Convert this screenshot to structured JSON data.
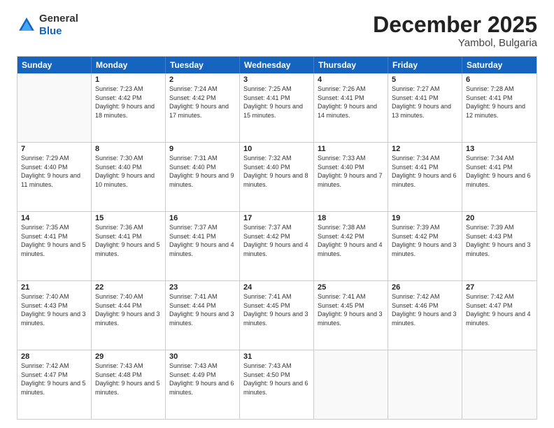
{
  "header": {
    "logo_general": "General",
    "logo_blue": "Blue",
    "title": "December 2025",
    "location": "Yambol, Bulgaria"
  },
  "days_of_week": [
    "Sunday",
    "Monday",
    "Tuesday",
    "Wednesday",
    "Thursday",
    "Friday",
    "Saturday"
  ],
  "weeks": [
    [
      {
        "day": "",
        "empty": true
      },
      {
        "day": "1",
        "sunrise": "Sunrise: 7:23 AM",
        "sunset": "Sunset: 4:42 PM",
        "daylight": "Daylight: 9 hours and 18 minutes."
      },
      {
        "day": "2",
        "sunrise": "Sunrise: 7:24 AM",
        "sunset": "Sunset: 4:42 PM",
        "daylight": "Daylight: 9 hours and 17 minutes."
      },
      {
        "day": "3",
        "sunrise": "Sunrise: 7:25 AM",
        "sunset": "Sunset: 4:41 PM",
        "daylight": "Daylight: 9 hours and 15 minutes."
      },
      {
        "day": "4",
        "sunrise": "Sunrise: 7:26 AM",
        "sunset": "Sunset: 4:41 PM",
        "daylight": "Daylight: 9 hours and 14 minutes."
      },
      {
        "day": "5",
        "sunrise": "Sunrise: 7:27 AM",
        "sunset": "Sunset: 4:41 PM",
        "daylight": "Daylight: 9 hours and 13 minutes."
      },
      {
        "day": "6",
        "sunrise": "Sunrise: 7:28 AM",
        "sunset": "Sunset: 4:41 PM",
        "daylight": "Daylight: 9 hours and 12 minutes."
      }
    ],
    [
      {
        "day": "7",
        "sunrise": "Sunrise: 7:29 AM",
        "sunset": "Sunset: 4:40 PM",
        "daylight": "Daylight: 9 hours and 11 minutes."
      },
      {
        "day": "8",
        "sunrise": "Sunrise: 7:30 AM",
        "sunset": "Sunset: 4:40 PM",
        "daylight": "Daylight: 9 hours and 10 minutes."
      },
      {
        "day": "9",
        "sunrise": "Sunrise: 7:31 AM",
        "sunset": "Sunset: 4:40 PM",
        "daylight": "Daylight: 9 hours and 9 minutes."
      },
      {
        "day": "10",
        "sunrise": "Sunrise: 7:32 AM",
        "sunset": "Sunset: 4:40 PM",
        "daylight": "Daylight: 9 hours and 8 minutes."
      },
      {
        "day": "11",
        "sunrise": "Sunrise: 7:33 AM",
        "sunset": "Sunset: 4:40 PM",
        "daylight": "Daylight: 9 hours and 7 minutes."
      },
      {
        "day": "12",
        "sunrise": "Sunrise: 7:34 AM",
        "sunset": "Sunset: 4:41 PM",
        "daylight": "Daylight: 9 hours and 6 minutes."
      },
      {
        "day": "13",
        "sunrise": "Sunrise: 7:34 AM",
        "sunset": "Sunset: 4:41 PM",
        "daylight": "Daylight: 9 hours and 6 minutes."
      }
    ],
    [
      {
        "day": "14",
        "sunrise": "Sunrise: 7:35 AM",
        "sunset": "Sunset: 4:41 PM",
        "daylight": "Daylight: 9 hours and 5 minutes."
      },
      {
        "day": "15",
        "sunrise": "Sunrise: 7:36 AM",
        "sunset": "Sunset: 4:41 PM",
        "daylight": "Daylight: 9 hours and 5 minutes."
      },
      {
        "day": "16",
        "sunrise": "Sunrise: 7:37 AM",
        "sunset": "Sunset: 4:41 PM",
        "daylight": "Daylight: 9 hours and 4 minutes."
      },
      {
        "day": "17",
        "sunrise": "Sunrise: 7:37 AM",
        "sunset": "Sunset: 4:42 PM",
        "daylight": "Daylight: 9 hours and 4 minutes."
      },
      {
        "day": "18",
        "sunrise": "Sunrise: 7:38 AM",
        "sunset": "Sunset: 4:42 PM",
        "daylight": "Daylight: 9 hours and 4 minutes."
      },
      {
        "day": "19",
        "sunrise": "Sunrise: 7:39 AM",
        "sunset": "Sunset: 4:42 PM",
        "daylight": "Daylight: 9 hours and 3 minutes."
      },
      {
        "day": "20",
        "sunrise": "Sunrise: 7:39 AM",
        "sunset": "Sunset: 4:43 PM",
        "daylight": "Daylight: 9 hours and 3 minutes."
      }
    ],
    [
      {
        "day": "21",
        "sunrise": "Sunrise: 7:40 AM",
        "sunset": "Sunset: 4:43 PM",
        "daylight": "Daylight: 9 hours and 3 minutes."
      },
      {
        "day": "22",
        "sunrise": "Sunrise: 7:40 AM",
        "sunset": "Sunset: 4:44 PM",
        "daylight": "Daylight: 9 hours and 3 minutes."
      },
      {
        "day": "23",
        "sunrise": "Sunrise: 7:41 AM",
        "sunset": "Sunset: 4:44 PM",
        "daylight": "Daylight: 9 hours and 3 minutes."
      },
      {
        "day": "24",
        "sunrise": "Sunrise: 7:41 AM",
        "sunset": "Sunset: 4:45 PM",
        "daylight": "Daylight: 9 hours and 3 minutes."
      },
      {
        "day": "25",
        "sunrise": "Sunrise: 7:41 AM",
        "sunset": "Sunset: 4:45 PM",
        "daylight": "Daylight: 9 hours and 3 minutes."
      },
      {
        "day": "26",
        "sunrise": "Sunrise: 7:42 AM",
        "sunset": "Sunset: 4:46 PM",
        "daylight": "Daylight: 9 hours and 3 minutes."
      },
      {
        "day": "27",
        "sunrise": "Sunrise: 7:42 AM",
        "sunset": "Sunset: 4:47 PM",
        "daylight": "Daylight: 9 hours and 4 minutes."
      }
    ],
    [
      {
        "day": "28",
        "sunrise": "Sunrise: 7:42 AM",
        "sunset": "Sunset: 4:47 PM",
        "daylight": "Daylight: 9 hours and 5 minutes."
      },
      {
        "day": "29",
        "sunrise": "Sunrise: 7:43 AM",
        "sunset": "Sunset: 4:48 PM",
        "daylight": "Daylight: 9 hours and 5 minutes."
      },
      {
        "day": "30",
        "sunrise": "Sunrise: 7:43 AM",
        "sunset": "Sunset: 4:49 PM",
        "daylight": "Daylight: 9 hours and 6 minutes."
      },
      {
        "day": "31",
        "sunrise": "Sunrise: 7:43 AM",
        "sunset": "Sunset: 4:50 PM",
        "daylight": "Daylight: 9 hours and 6 minutes."
      },
      {
        "day": "",
        "empty": true
      },
      {
        "day": "",
        "empty": true
      },
      {
        "day": "",
        "empty": true
      }
    ]
  ]
}
